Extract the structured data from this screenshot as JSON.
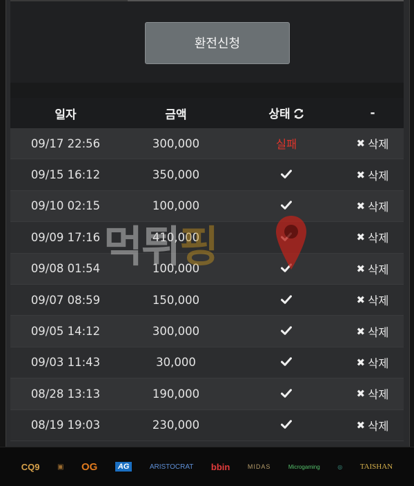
{
  "apply_button": {
    "label": "환전신청"
  },
  "table": {
    "headers": {
      "date": "일자",
      "amount": "금액",
      "status": "상태",
      "action": "-"
    },
    "rows": [
      {
        "date": "09/17 22:56",
        "amount": "300,000",
        "status": "실패",
        "status_type": "fail",
        "action": "삭제"
      },
      {
        "date": "09/15 16:12",
        "amount": "350,000",
        "status": "",
        "status_type": "check",
        "action": "삭제"
      },
      {
        "date": "09/10 02:15",
        "amount": "100,000",
        "status": "",
        "status_type": "check",
        "action": "삭제"
      },
      {
        "date": "09/09 17:16",
        "amount": "410,000",
        "status": "",
        "status_type": "check",
        "action": "삭제"
      },
      {
        "date": "09/08 01:54",
        "amount": "100,000",
        "status": "",
        "status_type": "check",
        "action": "삭제"
      },
      {
        "date": "09/07 08:59",
        "amount": "150,000",
        "status": "",
        "status_type": "check",
        "action": "삭제"
      },
      {
        "date": "09/05 14:12",
        "amount": "300,000",
        "status": "",
        "status_type": "check",
        "action": "삭제"
      },
      {
        "date": "09/03 11:43",
        "amount": "30,000",
        "status": "",
        "status_type": "check",
        "action": "삭제"
      },
      {
        "date": "08/28 13:13",
        "amount": "190,000",
        "status": "",
        "status_type": "check",
        "action": "삭제"
      },
      {
        "date": "08/19 19:03",
        "amount": "230,000",
        "status": "",
        "status_type": "check",
        "action": "삭제"
      }
    ]
  },
  "watermark": {
    "text_a": "먹튀",
    "text_b": "핑"
  },
  "footer": {
    "logos": [
      "CQ9",
      "▣",
      "OG",
      "AG",
      "ARISTOCRAT",
      "bbin",
      "MIDAS",
      "Microgaming",
      "◎",
      "TAISHAN"
    ]
  },
  "colors": {
    "fail": "#e0342b",
    "button": "#6a7073",
    "watermark_gold": "#c8961f"
  }
}
